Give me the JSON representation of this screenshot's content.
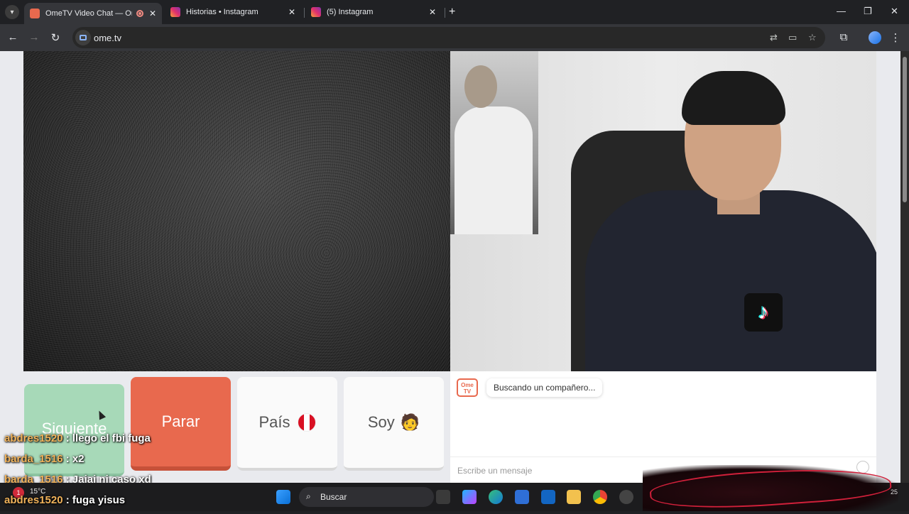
{
  "browser": {
    "tabs": [
      {
        "title": "OmeTV Video Chat — Ome",
        "active": true,
        "recording": true
      },
      {
        "title": "Historias • Instagram",
        "active": false
      },
      {
        "title": "(5) Instagram",
        "active": false
      }
    ],
    "url": "ome.tv"
  },
  "controls": {
    "next_label": "Siguiente",
    "stop_label": "Parar",
    "country_label": "País",
    "gender_label": "Soy",
    "gender_emoji": "🧑"
  },
  "chat": {
    "logo_line1": "Ome",
    "logo_line2": "TV",
    "status": "Buscando un compañero...",
    "input_placeholder": "Escribe un mensaje"
  },
  "overlay_chat": [
    {
      "user": "abdres1520",
      "text": " : llego el fbi fuga"
    },
    {
      "user": "barda_1516",
      "text": " : x2"
    },
    {
      "user": "barda_1516",
      "text": " : Jajaj ni caso xd"
    },
    {
      "user": "abdres1520",
      "text": " : fuga yisus"
    }
  ],
  "taskbar": {
    "weather_badge": "1",
    "temperature": "15°C",
    "search_label": "Buscar",
    "clock_fragment": "25"
  },
  "colors": {
    "stop": "#e8694e",
    "next": "#a7d9b8",
    "chat_username": "#f0b25a"
  }
}
